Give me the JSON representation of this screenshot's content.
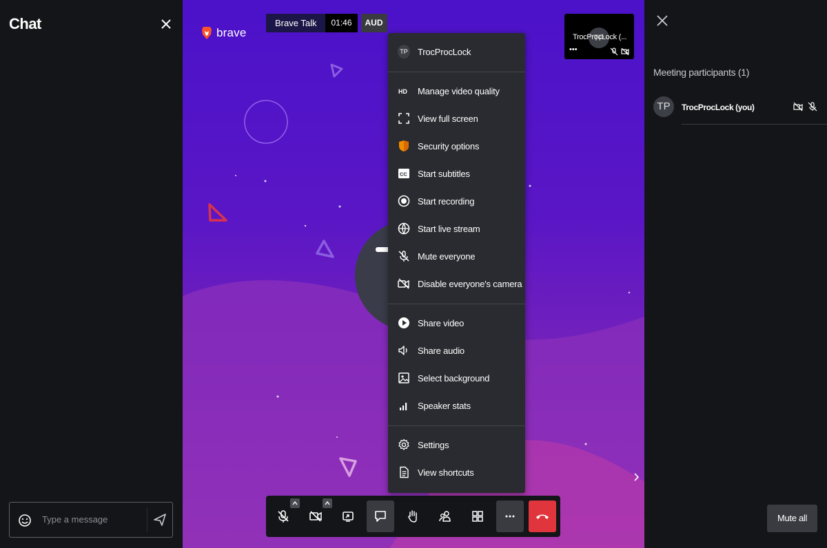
{
  "chat": {
    "title": "Chat",
    "input_placeholder": "Type a message"
  },
  "stage": {
    "brand": "brave",
    "meeting_name": "Brave Talk",
    "timer": "01:46",
    "audio_badge": "AUD",
    "thumbnail": {
      "avatar_initials": "TP",
      "name": "TrocProcLock (...",
      "more": "•••"
    }
  },
  "menu": {
    "profile": {
      "initials": "TP",
      "name": "TrocProcLock"
    },
    "groups": [
      [
        {
          "icon": "hd-icon",
          "label": "Manage video quality"
        },
        {
          "icon": "fullscreen-icon",
          "label": "View full screen"
        },
        {
          "icon": "shield-icon",
          "label": "Security options"
        },
        {
          "icon": "cc-icon",
          "label": "Start subtitles"
        },
        {
          "icon": "record-icon",
          "label": "Start recording"
        },
        {
          "icon": "live-stream-icon",
          "label": "Start live stream"
        },
        {
          "icon": "mic-off-icon",
          "label": "Mute everyone"
        },
        {
          "icon": "camera-off-icon",
          "label": "Disable everyone's camera"
        }
      ],
      [
        {
          "icon": "play-icon",
          "label": "Share video"
        },
        {
          "icon": "speaker-icon",
          "label": "Share audio"
        },
        {
          "icon": "image-icon",
          "label": "Select background"
        },
        {
          "icon": "bar-chart-icon",
          "label": "Speaker stats"
        }
      ],
      [
        {
          "icon": "gear-icon",
          "label": "Settings"
        },
        {
          "icon": "document-icon",
          "label": "View shortcuts"
        }
      ]
    ]
  },
  "toolbar": {
    "buttons": [
      "mic-off-icon",
      "camera-off-icon",
      "screen-share-icon",
      "chat-icon",
      "raise-hand-icon",
      "participants-icon",
      "tile-view-icon",
      "more-icon",
      "hangup-icon"
    ]
  },
  "participants": {
    "header": "Meeting participants (1)",
    "list": [
      {
        "initials": "TP",
        "name": "TrocProcLock (you)"
      }
    ],
    "mute_all": "Mute all"
  },
  "colors": {
    "accent": "#e0353d",
    "panel": "#141518",
    "menu": "#2a2b30",
    "brave_orange": "#fb542b"
  }
}
